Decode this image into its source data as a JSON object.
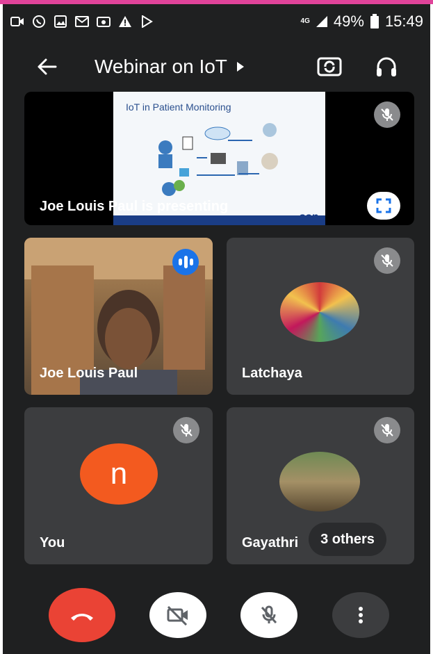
{
  "status_bar": {
    "network": "4G",
    "battery": "49%",
    "time": "15:49"
  },
  "header": {
    "title": "Webinar on IoT"
  },
  "presentation": {
    "presenter_text": "Joe Louis Paul is presenting",
    "slide_title": "IoT in Patient Monitoring",
    "slide_logo": "ssn"
  },
  "participants": [
    {
      "name": "Joe Louis Paul",
      "speaking": true
    },
    {
      "name": "Latchaya",
      "muted": true
    },
    {
      "name": "You",
      "avatar_letter": "n",
      "muted": true
    },
    {
      "name": "Gayathri",
      "muted": true
    }
  ],
  "others_badge": "3 others",
  "colors": {
    "accent_pink": "#e0439a",
    "end_call_red": "#ea4335",
    "speaking_blue": "#1a73e8",
    "avatar_orange": "#f35a1f"
  },
  "icons": [
    "back-arrow-icon",
    "caret-right-icon",
    "switch-camera-icon",
    "headset-icon",
    "mic-off-icon",
    "fullscreen-icon",
    "speaking-icon",
    "end-call-icon",
    "camera-off-icon",
    "more-vert-icon"
  ]
}
